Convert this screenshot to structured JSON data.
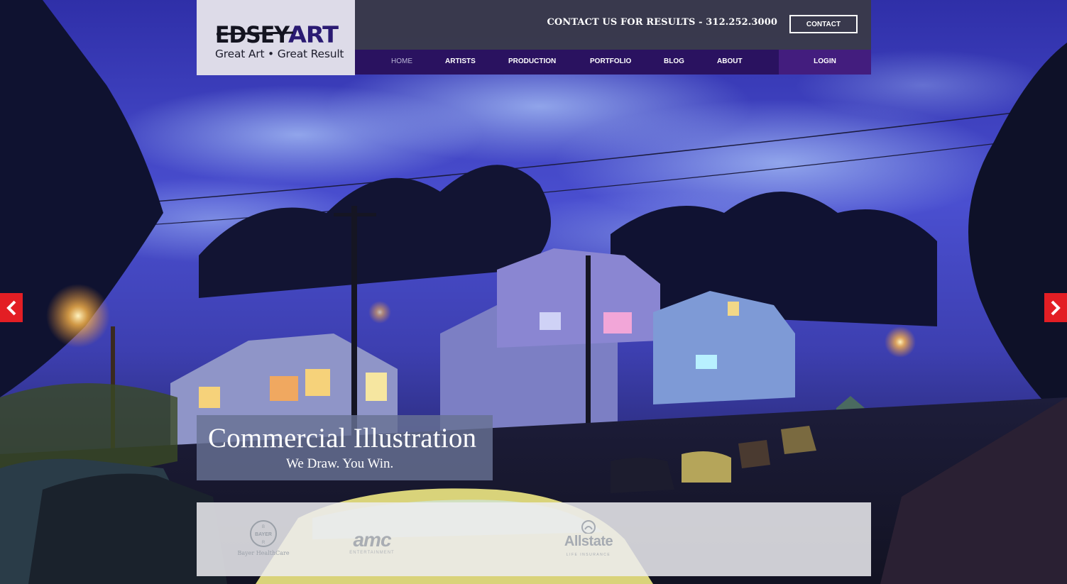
{
  "brand": {
    "logo_text": "EDSEYART",
    "tagline": "Great Art • Great Result"
  },
  "header": {
    "contact_line": "CONTACT US FOR RESULTS - 312.252.3000",
    "contact_button": "CONTACT"
  },
  "nav": {
    "items": [
      {
        "label": "HOME",
        "active": true
      },
      {
        "label": "ARTISTS"
      },
      {
        "label": "PRODUCTION"
      },
      {
        "label": "PORTFOLIO"
      },
      {
        "label": "BLOG"
      },
      {
        "label": "ABOUT"
      }
    ],
    "login": "LOGIN"
  },
  "slider": {
    "prev_icon": "chevron-left-icon",
    "next_icon": "chevron-right-icon",
    "caption_title": "Commercial Illustration",
    "caption_subtitle": "We Draw. You Win."
  },
  "clients": {
    "bayer": {
      "name": "Bayer HealthCare",
      "mark": "BAYER"
    },
    "amc": {
      "name": "amc",
      "sub": "ENTERTAINMENT"
    },
    "allstate": {
      "name": "Allstate",
      "sub": "LIFE INSURANCE"
    }
  },
  "colors": {
    "nav_bg": "#2a1260",
    "login_bg": "#431d7e",
    "arrow": "#e31e24",
    "top_bar": "#3a3a46"
  }
}
